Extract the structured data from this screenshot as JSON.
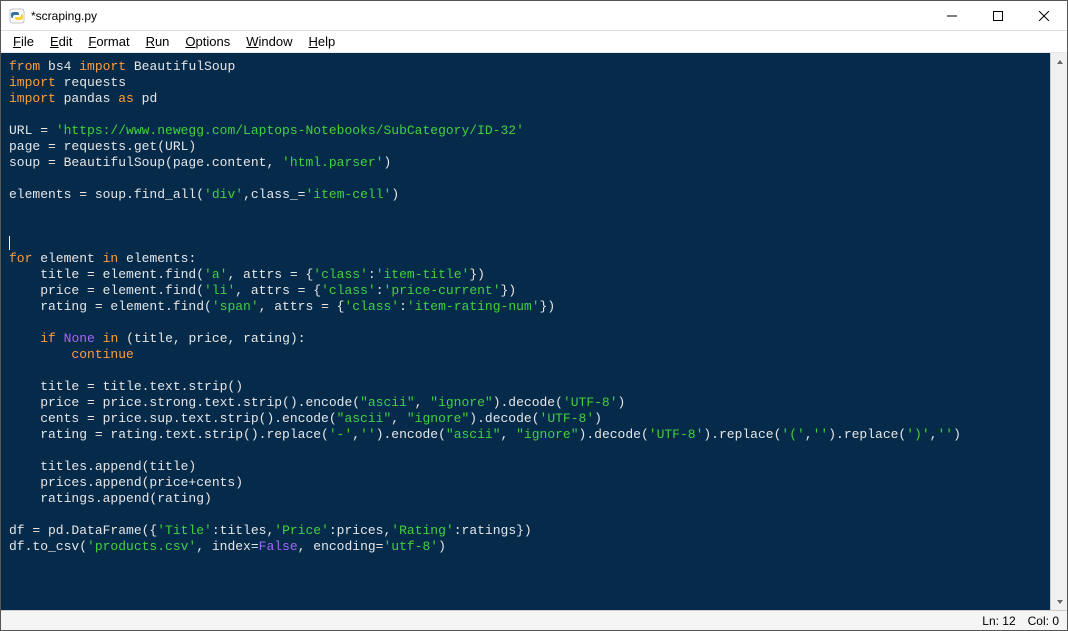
{
  "window": {
    "title": "*scraping.py"
  },
  "menu": {
    "file": "File",
    "edit": "Edit",
    "format": "Format",
    "run": "Run",
    "options": "Options",
    "window": "Window",
    "help": "Help"
  },
  "code": {
    "lines": [
      [
        [
          "kw",
          "from"
        ],
        [
          "txt",
          " bs4 "
        ],
        [
          "kw",
          "import"
        ],
        [
          "txt",
          " BeautifulSoup"
        ]
      ],
      [
        [
          "kw",
          "import"
        ],
        [
          "txt",
          " requests"
        ]
      ],
      [
        [
          "kw",
          "import"
        ],
        [
          "txt",
          " pandas "
        ],
        [
          "kw",
          "as"
        ],
        [
          "txt",
          " pd"
        ]
      ],
      [],
      [
        [
          "txt",
          "URL = "
        ],
        [
          "str",
          "'https://www.newegg.com/Laptops-Notebooks/SubCategory/ID-32'"
        ]
      ],
      [
        [
          "txt",
          "page = requests.get(URL)"
        ]
      ],
      [
        [
          "txt",
          "soup = BeautifulSoup(page.content, "
        ],
        [
          "str",
          "'html.parser'"
        ],
        [
          "txt",
          ")"
        ]
      ],
      [],
      [
        [
          "txt",
          "elements = soup.find_all("
        ],
        [
          "str",
          "'div'"
        ],
        [
          "txt",
          ",class_="
        ],
        [
          "str",
          "'item-cell'"
        ],
        [
          "txt",
          ")"
        ]
      ],
      [],
      [],
      [
        [
          "cursor",
          ""
        ]
      ],
      [
        [
          "kw",
          "for"
        ],
        [
          "txt",
          " element "
        ],
        [
          "kw",
          "in"
        ],
        [
          "txt",
          " elements:"
        ]
      ],
      [
        [
          "txt",
          "    title = element.find("
        ],
        [
          "str",
          "'a'"
        ],
        [
          "txt",
          ", attrs = {"
        ],
        [
          "str",
          "'class'"
        ],
        [
          "txt",
          ":"
        ],
        [
          "str",
          "'item-title'"
        ],
        [
          "txt",
          "})"
        ]
      ],
      [
        [
          "txt",
          "    price = element.find("
        ],
        [
          "str",
          "'li'"
        ],
        [
          "txt",
          ", attrs = {"
        ],
        [
          "str",
          "'class'"
        ],
        [
          "txt",
          ":"
        ],
        [
          "str",
          "'price-current'"
        ],
        [
          "txt",
          "})"
        ]
      ],
      [
        [
          "txt",
          "    rating = element.find("
        ],
        [
          "str",
          "'span'"
        ],
        [
          "txt",
          ", attrs = {"
        ],
        [
          "str",
          "'class'"
        ],
        [
          "txt",
          ":"
        ],
        [
          "str",
          "'item-rating-num'"
        ],
        [
          "txt",
          "})"
        ]
      ],
      [],
      [
        [
          "txt",
          "    "
        ],
        [
          "kw",
          "if"
        ],
        [
          "txt",
          " "
        ],
        [
          "bltn",
          "None"
        ],
        [
          "txt",
          " "
        ],
        [
          "kw",
          "in"
        ],
        [
          "txt",
          " (title, price, rating):"
        ]
      ],
      [
        [
          "txt",
          "        "
        ],
        [
          "kw",
          "continue"
        ]
      ],
      [],
      [
        [
          "txt",
          "    title = title.text.strip()"
        ]
      ],
      [
        [
          "txt",
          "    price = price.strong.text.strip().encode("
        ],
        [
          "str",
          "\"ascii\""
        ],
        [
          "txt",
          ", "
        ],
        [
          "str",
          "\"ignore\""
        ],
        [
          "txt",
          ").decode("
        ],
        [
          "str",
          "'UTF-8'"
        ],
        [
          "txt",
          ")"
        ]
      ],
      [
        [
          "txt",
          "    cents = price.sup.text.strip().encode("
        ],
        [
          "str",
          "\"ascii\""
        ],
        [
          "txt",
          ", "
        ],
        [
          "str",
          "\"ignore\""
        ],
        [
          "txt",
          ").decode("
        ],
        [
          "str",
          "'UTF-8'"
        ],
        [
          "txt",
          ")"
        ]
      ],
      [
        [
          "txt",
          "    rating = rating.text.strip().replace("
        ],
        [
          "str",
          "'-'"
        ],
        [
          "txt",
          ","
        ],
        [
          "str",
          "''"
        ],
        [
          "txt",
          ").encode("
        ],
        [
          "str",
          "\"ascii\""
        ],
        [
          "txt",
          ", "
        ],
        [
          "str",
          "\"ignore\""
        ],
        [
          "txt",
          ").decode("
        ],
        [
          "str",
          "'UTF-8'"
        ],
        [
          "txt",
          ").replace("
        ],
        [
          "str",
          "'('"
        ],
        [
          "txt",
          ","
        ],
        [
          "str",
          "''"
        ],
        [
          "txt",
          ").replace("
        ],
        [
          "str",
          "')'"
        ],
        [
          "txt",
          ","
        ],
        [
          "str",
          "''"
        ],
        [
          "txt",
          ")"
        ]
      ],
      [],
      [
        [
          "txt",
          "    titles.append(title)"
        ]
      ],
      [
        [
          "txt",
          "    prices.append(price+cents)"
        ]
      ],
      [
        [
          "txt",
          "    ratings.append(rating)"
        ]
      ],
      [],
      [
        [
          "txt",
          "df = pd.DataFrame({"
        ],
        [
          "str",
          "'Title'"
        ],
        [
          "txt",
          ":titles,"
        ],
        [
          "str",
          "'Price'"
        ],
        [
          "txt",
          ":prices,"
        ],
        [
          "str",
          "'Rating'"
        ],
        [
          "txt",
          ":ratings})"
        ]
      ],
      [
        [
          "txt",
          "df.to_csv("
        ],
        [
          "str",
          "'products.csv'"
        ],
        [
          "txt",
          ", index="
        ],
        [
          "bltn",
          "False"
        ],
        [
          "txt",
          ", encoding="
        ],
        [
          "str",
          "'utf-8'"
        ],
        [
          "txt",
          ")"
        ]
      ]
    ]
  },
  "status": {
    "line": "Ln: 12",
    "col": "Col: 0"
  }
}
